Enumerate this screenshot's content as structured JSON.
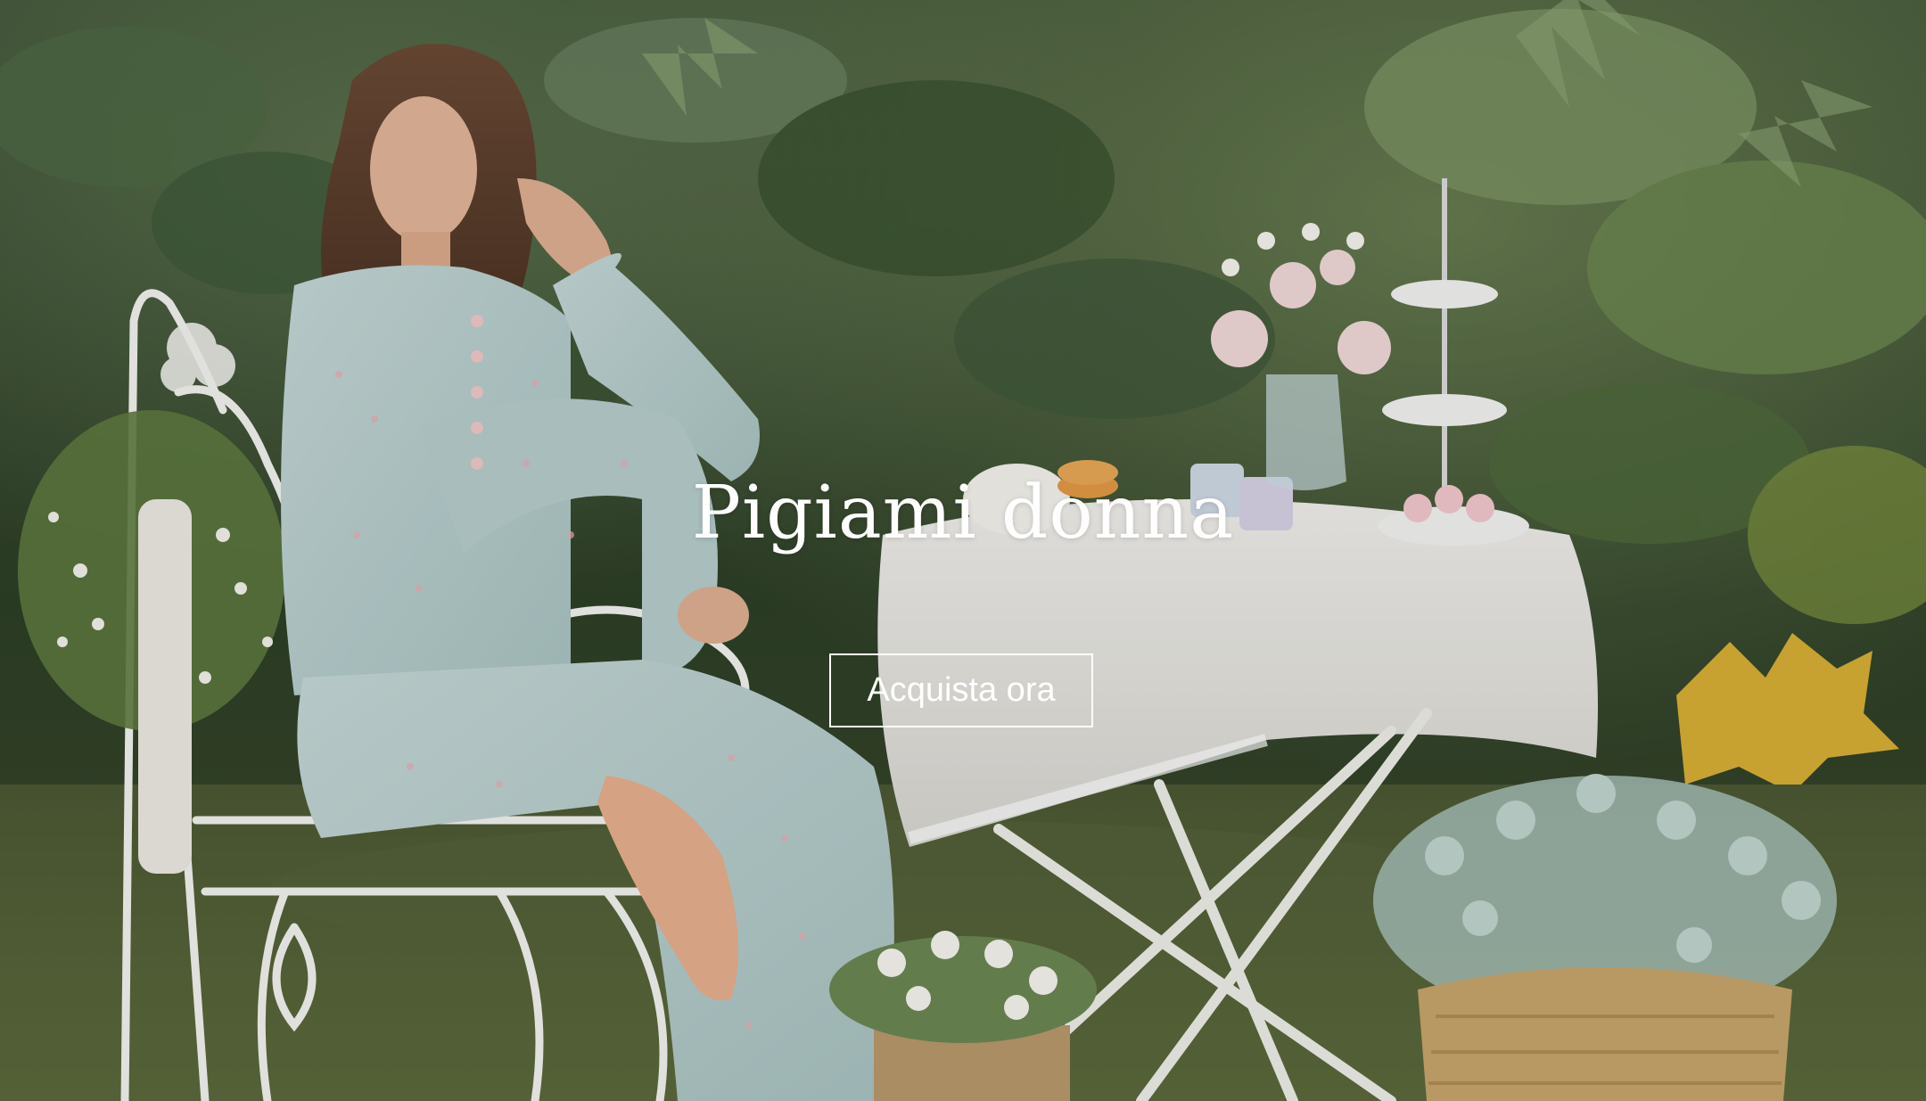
{
  "hero": {
    "title": "Pigiami donna",
    "cta_label": "Acquista ora",
    "colors": {
      "text": "#ffffff",
      "button_border": "#ffffff"
    }
  }
}
